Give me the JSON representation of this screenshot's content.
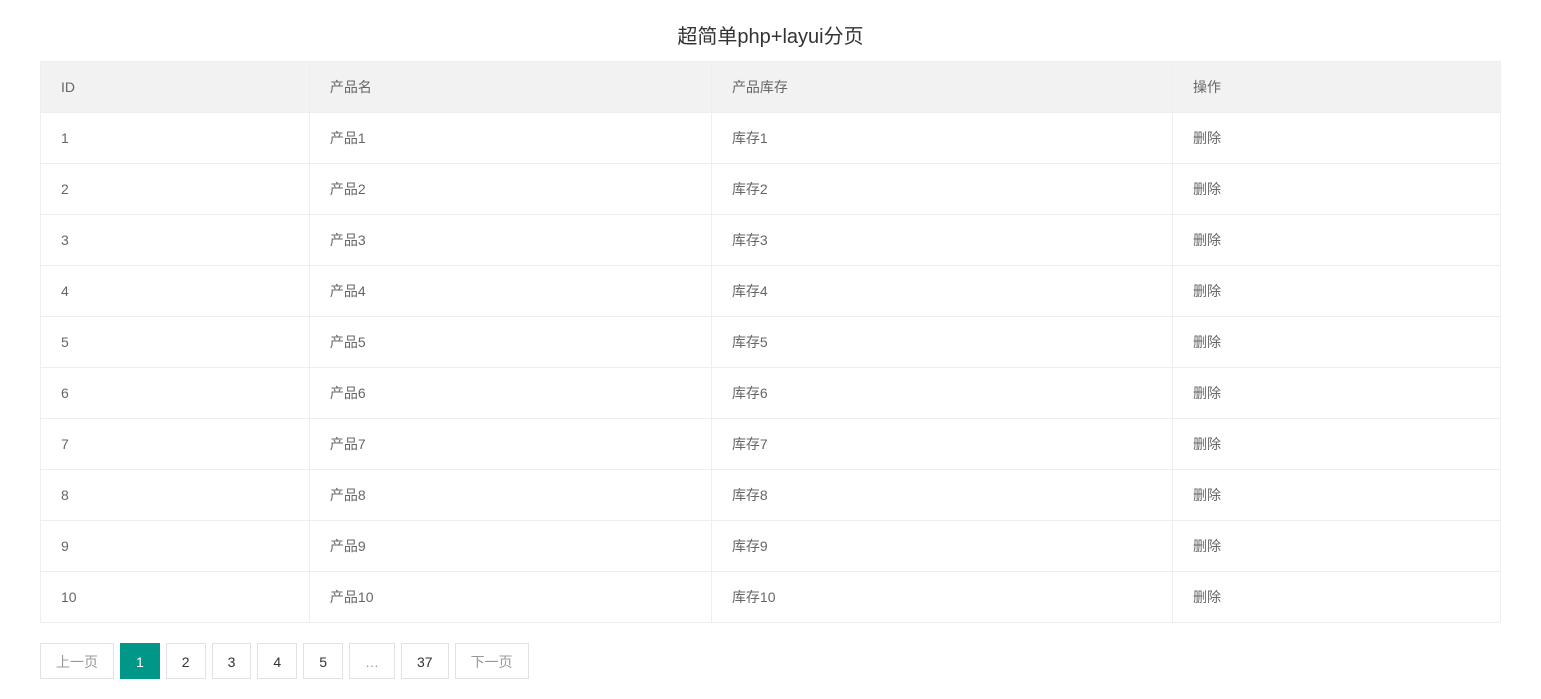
{
  "title": "超简单php+layui分页",
  "columns": {
    "id": "ID",
    "name": "产品名",
    "stock": "产品库存",
    "action": "操作"
  },
  "action_label": "删除",
  "rows": [
    {
      "id": "1",
      "name": "产品1",
      "stock": "库存1"
    },
    {
      "id": "2",
      "name": "产品2",
      "stock": "库存2"
    },
    {
      "id": "3",
      "name": "产品3",
      "stock": "库存3"
    },
    {
      "id": "4",
      "name": "产品4",
      "stock": "库存4"
    },
    {
      "id": "5",
      "name": "产品5",
      "stock": "库存5"
    },
    {
      "id": "6",
      "name": "产品6",
      "stock": "库存6"
    },
    {
      "id": "7",
      "name": "产品7",
      "stock": "库存7"
    },
    {
      "id": "8",
      "name": "产品8",
      "stock": "库存8"
    },
    {
      "id": "9",
      "name": "产品9",
      "stock": "库存9"
    },
    {
      "id": "10",
      "name": "产品10",
      "stock": "库存10"
    }
  ],
  "pagination": {
    "prev": "上一页",
    "next": "下一页",
    "ellipsis": "…",
    "pages": [
      "1",
      "2",
      "3",
      "4",
      "5"
    ],
    "last": "37",
    "current": "1"
  }
}
